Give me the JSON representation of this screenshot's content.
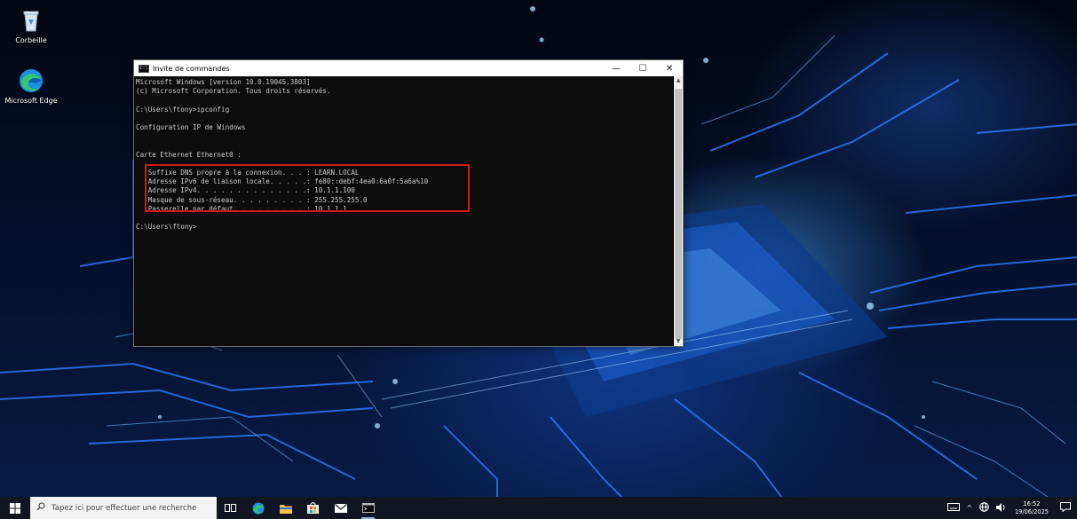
{
  "desktop": {
    "icons": [
      {
        "label": "Corbeille",
        "icon": "recycle-bin-icon"
      },
      {
        "label": "Microsoft Edge",
        "icon": "edge-icon"
      }
    ]
  },
  "window": {
    "title": "Invite de commandes",
    "controls": {
      "minimize": "—",
      "maximize": "☐",
      "close": "✕"
    },
    "console_lines": [
      "Microsoft Windows [version 10.0.19045.3803]",
      "(c) Microsoft Corporation. Tous droits réservés.",
      "",
      "C:\\Users\\ftony>ipconfig",
      "",
      "Configuration IP de Windows",
      "",
      "",
      "Carte Ethernet Ethernet0 :",
      "",
      "   Suffixe DNS propre à la connexion. . . : LEARN.LOCAL",
      "   Adresse IPv6 de liaison locale. . . . .: fe80::debf:4ea0:6a0f:5a6a%10",
      "   Adresse IPv4. . . . . . . . . . . . . .: 10.1.1.100",
      "   Masque de sous-réseau. . . . . . . . . : 255.255.255.0",
      "   Passerelle par défaut. . . . . . . . . : 10.1.1.1",
      "",
      "C:\\Users\\ftony>"
    ]
  },
  "taskbar": {
    "search_placeholder": "Tapez ici pour effectuer une recherche",
    "pinned": [
      {
        "icon": "task-view-icon"
      },
      {
        "icon": "edge-icon"
      },
      {
        "icon": "file-explorer-icon"
      },
      {
        "icon": "store-icon"
      },
      {
        "icon": "mail-icon"
      },
      {
        "icon": "command-prompt-icon",
        "active": true
      }
    ],
    "time": "16:52",
    "date": "19/06/2025",
    "tray_icons": [
      "keyboard-icon",
      "chevron-up-icon",
      "network-icon",
      "volume-icon",
      "notification-icon"
    ]
  },
  "colors": {
    "highlight": "#d11a1a",
    "console_bg": "#0c0c0c",
    "console_fg": "#cccccc",
    "taskbar_bg": "#101521"
  }
}
